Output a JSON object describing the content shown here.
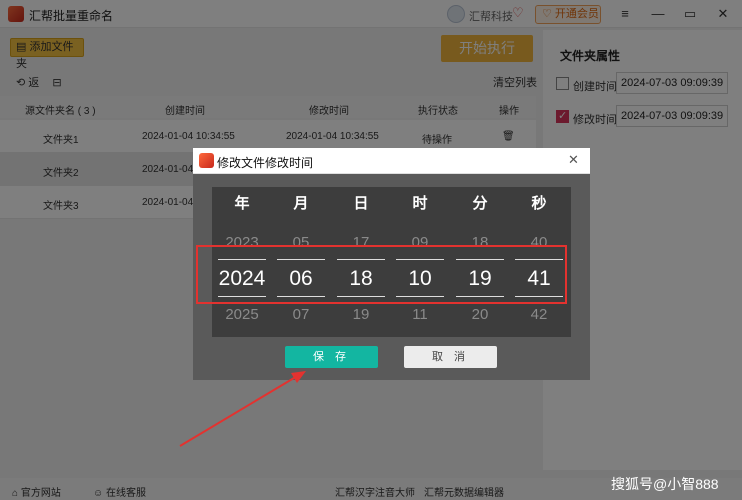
{
  "app": {
    "title": "汇帮批量重命名",
    "user_name": "汇帮科技",
    "vip_label": "开通会员",
    "add_folder_label": "添加文件夹",
    "start_label": "开始执行",
    "back_label": "返",
    "clear_list_label": "清空列表"
  },
  "table": {
    "headers": [
      "源文件夹名 ( 3 )",
      "创建时间",
      "修改时间",
      "执行状态",
      "操作"
    ],
    "rows": [
      {
        "name": "文件夹1",
        "created": "2024-01-04 10:34:55",
        "modified": "2024-01-04 10:34:55",
        "status": "待操作"
      },
      {
        "name": "文件夹2",
        "created": "2024-01-04 1",
        "modified": "",
        "status": ""
      },
      {
        "name": "文件夹3",
        "created": "2024-01-04 1",
        "modified": "",
        "status": ""
      }
    ]
  },
  "props": {
    "title": "文件夹属性",
    "created_label": "创建时间",
    "created_value": "2024-07-03 09:09:39",
    "created_checked": false,
    "modified_label": "修改时间",
    "modified_value": "2024-07-03 09:09:39",
    "modified_checked": true
  },
  "footer": {
    "website": "官方网站",
    "service": "在线客服",
    "product1": "汇帮汉字注音大师",
    "product2": "汇帮元数据编辑器"
  },
  "dialog": {
    "title": "修改文件修改时间",
    "columns": [
      {
        "label": "年",
        "prev": "2023",
        "current": "2024",
        "next": "2025"
      },
      {
        "label": "月",
        "prev": "05",
        "current": "06",
        "next": "07"
      },
      {
        "label": "日",
        "prev": "17",
        "current": "18",
        "next": "19"
      },
      {
        "label": "时",
        "prev": "09",
        "current": "10",
        "next": "11"
      },
      {
        "label": "分",
        "prev": "18",
        "current": "19",
        "next": "20"
      },
      {
        "label": "秒",
        "prev": "40",
        "current": "41",
        "next": "42"
      }
    ],
    "save_label": "保 存",
    "cancel_label": "取 消"
  },
  "watermark": "搜狐号@小智888",
  "colors": {
    "accent_save": "#13b6a1",
    "highlight_red": "#e3322f",
    "start_orange": "#f0b53c",
    "checkbox_pink": "#d9345c"
  }
}
